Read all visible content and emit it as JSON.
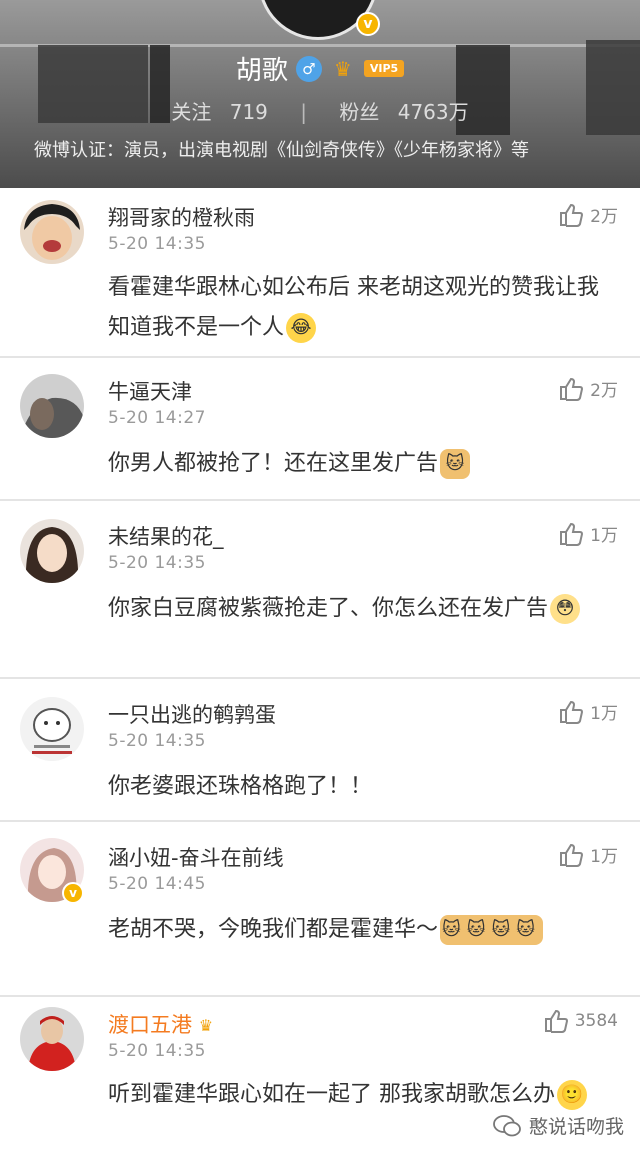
{
  "profile": {
    "name": "胡歌",
    "vip_label": "VIP5",
    "following_label": "关注",
    "following_count": "719",
    "separator": "|",
    "followers_label": "粉丝",
    "followers_count": "4763万",
    "verification": "微博认证：演员，出演电视剧《仙剑奇侠传》《少年杨家将》等"
  },
  "comments": [
    {
      "user": "翔哥家的橙秋雨",
      "time": "5-20 14:35",
      "likes": "2万",
      "text": "看霍建华跟林心如公布后 来老胡这观光的赞我让我知道我不是一个人",
      "emoji": "😂"
    },
    {
      "user": "牛逼天津",
      "time": "5-20 14:27",
      "likes": "2万",
      "text": "你男人都被抢了！还在这里发广告",
      "emoji": "🐱"
    },
    {
      "user": "未结果的花_",
      "time": "5-20 14:35",
      "likes": "1万",
      "text": "你家白豆腐被紫薇抢走了、你怎么还在发广告",
      "emoji": "😳"
    },
    {
      "user": "一只出逃的鹌鹑蛋",
      "time": "5-20 14:35",
      "likes": "1万",
      "text": "你老婆跟还珠格格跑了！！",
      "emoji": ""
    },
    {
      "user": "涵小妞-奋斗在前线",
      "time": "5-20 14:45",
      "likes": "1万",
      "text": "老胡不哭，今晚我们都是霍建华～",
      "emoji": "🐱🐱🐱🐱"
    },
    {
      "user": "渡口五港",
      "time": "5-20 14:35",
      "likes": "3584",
      "text": "听到霍建华跟心如在一起了 那我家胡歌怎么办",
      "emoji": "🙂"
    }
  ],
  "watermark": {
    "text": "憨说话吻我"
  },
  "colors": {
    "username_highlight": "#f47b20",
    "verified_badge": "#f7b500",
    "vip": "#f4a421"
  }
}
